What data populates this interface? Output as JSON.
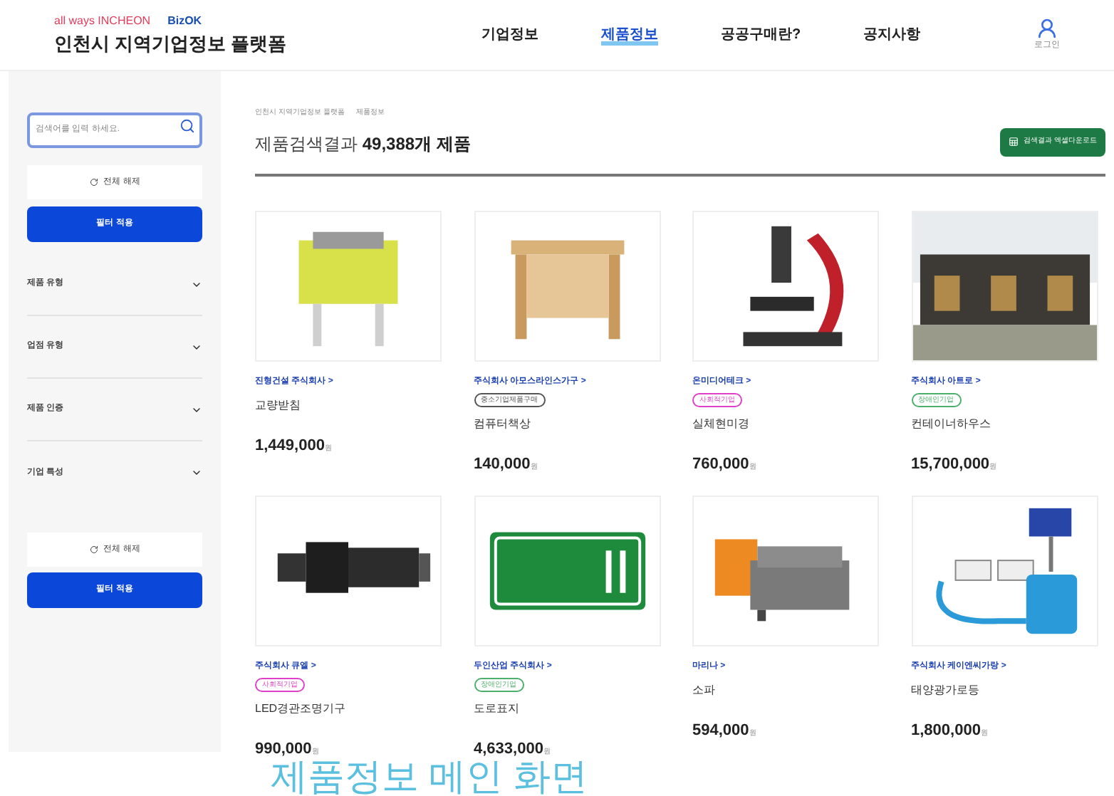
{
  "logo": {
    "tagline": "all ways INCHEON",
    "partner": "BizOK",
    "title": "인천시 지역기업정보 플랫폼"
  },
  "nav": [
    {
      "label": "기업정보",
      "selected": false
    },
    {
      "label": "제품정보",
      "selected": true
    },
    {
      "label": "공공구매란?",
      "selected": false
    },
    {
      "label": "공지사항",
      "selected": false
    }
  ],
  "login": "로그인",
  "sidebar": {
    "search": {
      "placeholder": "검색어를 입력 하세요."
    },
    "reset_top": "전체 해제",
    "apply_top": "필터 적용",
    "reset_bottom": "전체 해제",
    "apply_bottom": "필터 적용",
    "filters": [
      {
        "label": "제품 유형",
        "expanded": false
      },
      {
        "label": "업점 유형",
        "expanded": false
      },
      {
        "label": "제품 인증",
        "expanded": false
      },
      {
        "label": "기업 특성",
        "expanded": false
      }
    ]
  },
  "breadcrumb": [
    "인천시 지역기업정보 플랫폼",
    "제품정보"
  ],
  "results": {
    "label": "제품검색결과",
    "count": "49,388개 제품"
  },
  "export_button": "검색결과 엑셀다운로드",
  "products": [
    {
      "company": "진형건설 주식회사 >",
      "name": "교량받침",
      "price": "1,449,000",
      "unit": "원"
    },
    {
      "company": "주식회사 아모스라인스가구 >",
      "badge": "중소기업제품구매",
      "color": "#555555",
      "name": "컴퓨터책상",
      "price": "140,000",
      "unit": "원"
    },
    {
      "company": "온미디어테크 >",
      "badge": "사회적기업",
      "color": "#e040c8",
      "name": "실체현미경",
      "price": "760,000",
      "unit": "원"
    },
    {
      "company": "주식회사 아트로 >",
      "badge": "장애인기업",
      "color": "#4caf6a",
      "name": "컨테이너하우스",
      "price": "15,700,000",
      "unit": "원"
    },
    {
      "company": "주식회사 큐엘 >",
      "badge": "사회적기업",
      "color": "#e040c8",
      "name": "LED경관조명기구",
      "price": "990,000",
      "unit": "원"
    },
    {
      "company": "두인산업 주식회사 >",
      "badge": "장애인기업",
      "color": "#4caf6a",
      "name": "도로표지",
      "price": "4,633,000",
      "unit": "원"
    },
    {
      "company": "마리나 >",
      "name": "소파",
      "price": "594,000",
      "unit": "원"
    },
    {
      "company": "주식회사 케이엔씨가랑 >",
      "name": "태양광가로등",
      "price": "1,800,000",
      "unit": "원"
    }
  ],
  "caption": "제품정보 메인 화면"
}
